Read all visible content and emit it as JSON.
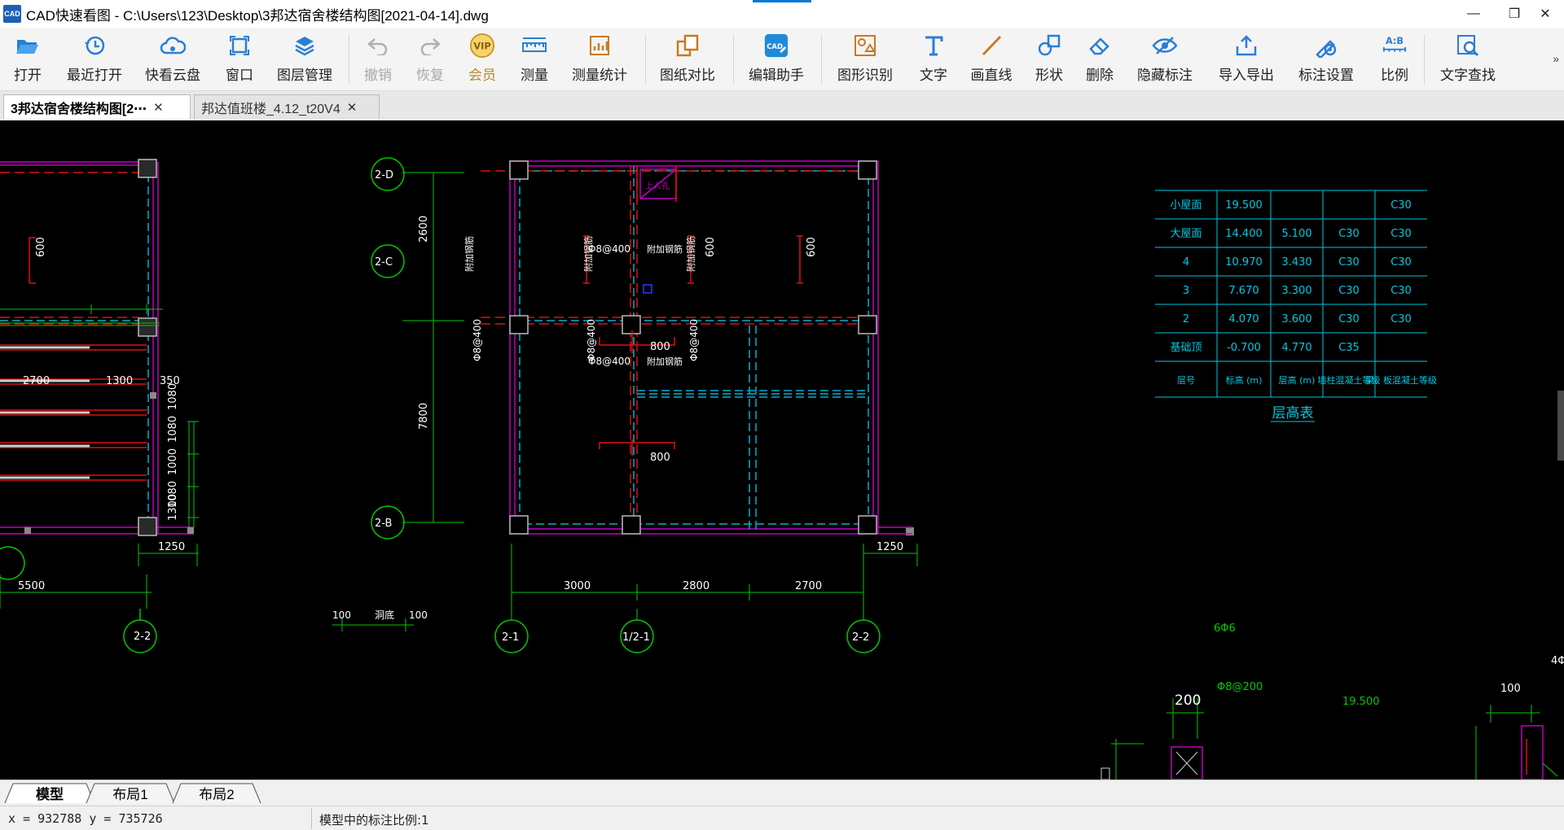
{
  "window": {
    "title": "CAD快速看图 - C:\\Users\\123\\Desktop\\3邦达宿舍楼结构图[2021-04-14].dwg",
    "logo_text": "CAD",
    "minimize": "—",
    "restore": "❐",
    "close": "✕"
  },
  "toolbar": {
    "items": [
      {
        "label": "打开",
        "icon": "folder-open-icon"
      },
      {
        "label": "最近打开",
        "icon": "clock-icon"
      },
      {
        "label": "快看云盘",
        "icon": "cloud-icon"
      },
      {
        "label": "窗口",
        "icon": "window-icon"
      },
      {
        "label": "图层管理",
        "icon": "layers-icon"
      },
      {
        "label": "撤销",
        "icon": "undo-icon"
      },
      {
        "label": "恢复",
        "icon": "redo-icon"
      },
      {
        "label": "会员",
        "icon": "vip-icon",
        "badge": "VIP"
      },
      {
        "label": "测量",
        "icon": "ruler-icon"
      },
      {
        "label": "测量统计",
        "icon": "measure-stats-icon"
      },
      {
        "label": "图纸对比",
        "icon": "compare-icon"
      },
      {
        "label": "编辑助手",
        "icon": "edit-assistant-icon",
        "badge": "CAD"
      },
      {
        "label": "图形识别",
        "icon": "shape-recognize-icon"
      },
      {
        "label": "文字",
        "icon": "text-icon"
      },
      {
        "label": "画直线",
        "icon": "line-icon"
      },
      {
        "label": "形状",
        "icon": "shape-icon"
      },
      {
        "label": "删除",
        "icon": "eraser-icon"
      },
      {
        "label": "隐藏标注",
        "icon": "hide-annotation-icon"
      },
      {
        "label": "导入导出",
        "icon": "import-export-icon"
      },
      {
        "label": "标注设置",
        "icon": "annotation-settings-icon"
      },
      {
        "label": "比例",
        "icon": "scale-icon",
        "badge": "A:B"
      },
      {
        "label": "文字查找",
        "icon": "text-search-icon"
      }
    ],
    "more": "»"
  },
  "doc_tabs": [
    {
      "label": "3邦达宿舍楼结构图[2⋯",
      "close": "✕"
    },
    {
      "label": "邦达值班楼_4.12_t20V4",
      "close": "✕"
    }
  ],
  "drawing": {
    "axis_labels": [
      "2-D",
      "2-C",
      "2-B",
      "2-1",
      "1/2-1",
      "2-2",
      "2-2"
    ],
    "dims_left": [
      "2700",
      "1300",
      "350",
      "5500",
      "1250",
      "1080",
      "1000",
      "1080",
      "1080",
      "1300",
      "600"
    ],
    "dims_main": [
      "2600",
      "7800",
      "3000",
      "2800",
      "2700",
      "1250",
      "800",
      "800",
      "600",
      "600",
      "100",
      "100"
    ],
    "rebar_notes": [
      "Φ8@400",
      "Φ8@400",
      "Φ8@400",
      "Φ8@400",
      "Φ8@400",
      "附加钢筋",
      "附加钢筋",
      "附加钢筋",
      "附加钢筋",
      "附加钢筋",
      "上人孔",
      "洞底"
    ],
    "right_notes": [
      "6Φ6",
      "Φ8@200",
      "200",
      "19.500",
      "100",
      "4Φ"
    ],
    "table": {
      "rows": [
        [
          "小屋面",
          "19.500",
          "",
          "",
          "C30"
        ],
        [
          "大屋面",
          "14.400",
          "5.100",
          "C30",
          "C30"
        ],
        [
          "4",
          "10.970",
          "3.430",
          "C30",
          "C30"
        ],
        [
          "3",
          "7.670",
          "3.300",
          "C30",
          "C30"
        ],
        [
          "2",
          "4.070",
          "3.600",
          "C30",
          "C30"
        ],
        [
          "基础顶",
          "-0.700",
          "4.770",
          "C35",
          ""
        ]
      ],
      "header": [
        "层号",
        "标高 (m)",
        "层高 (m)",
        "墙柱混凝土等级",
        "梁、板混凝土等级"
      ],
      "caption": "层高表"
    }
  },
  "layout_tabs": [
    "模型",
    "布局1",
    "布局2"
  ],
  "status": {
    "coords": "x = 932788  y = 735726",
    "scale": "模型中的标注比例:1"
  },
  "colors": {
    "canvas_bg": "#000000",
    "magenta": "#c000c0",
    "red": "#e01010",
    "green": "#00c800",
    "cyan": "#00b0d0",
    "white": "#ffffff",
    "gray": "#8a8a8a"
  }
}
